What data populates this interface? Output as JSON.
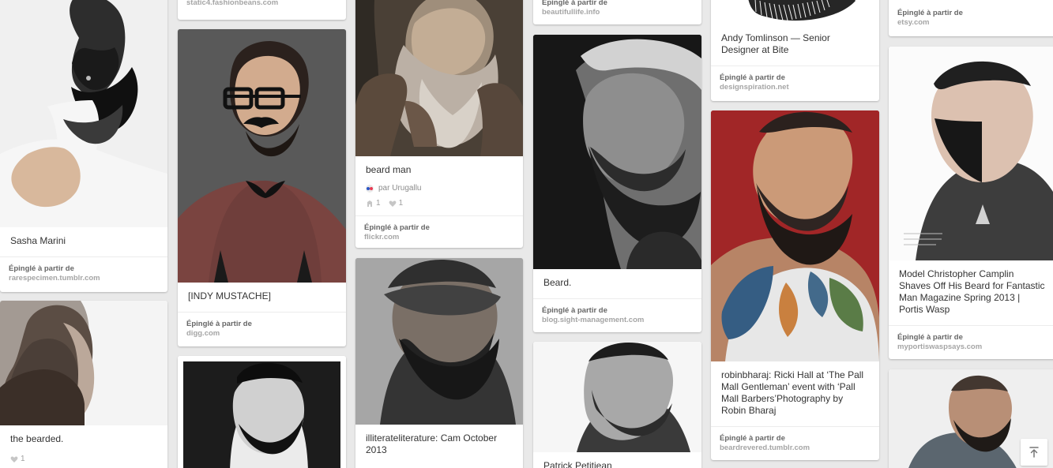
{
  "columns": [
    {
      "pins": [
        {
          "description": "Sasha Marini",
          "source": {
            "label": "Épinglé à partir de",
            "domain": "rarespecimen.tumblr.com"
          }
        },
        {
          "description": "the bearded.",
          "stats": {
            "likes": "1"
          }
        }
      ]
    },
    {
      "pins": [
        {
          "source": {
            "domain": "static4.fashionbeans.com"
          }
        },
        {
          "description": "[INDY MUSTACHE]",
          "source": {
            "label": "Épinglé à partir de",
            "domain": "digg.com"
          }
        }
      ]
    },
    {
      "pins": [
        {
          "description": "beard man",
          "pinner": "par Urugallu",
          "stats": {
            "repins": "1",
            "likes": "1"
          },
          "source": {
            "label": "Épinglé à partir de",
            "domain": "flickr.com"
          }
        },
        {
          "description": "illiterateliterature: Cam October 2013"
        }
      ]
    },
    {
      "pins": [
        {
          "source": {
            "label": "Épinglé à partir de",
            "domain": "beautifullife.info"
          }
        },
        {
          "description": "Beard.",
          "source": {
            "label": "Épinglé à partir de",
            "domain": "blog.sight-management.com"
          }
        },
        {
          "description": "Patrick Petitjean"
        }
      ]
    },
    {
      "pins": [
        {
          "description": "Andy Tomlinson — Senior Designer at Bite",
          "source": {
            "label": "Épinglé à partir de",
            "domain": "designspiration.net"
          }
        },
        {
          "description": "robinbharaj: Ricki Hall at ‘The Pall Mall Gentleman’ event with ‘Pall Mall Barbers’Photography by Robin Bharaj",
          "source": {
            "label": "Épinglé à partir de",
            "domain": "beardrevered.tumblr.com"
          }
        }
      ]
    },
    {
      "pins": [
        {
          "source": {
            "label": "Épinglé à partir de",
            "domain": "etsy.com"
          }
        },
        {
          "description": "Model Christopher Camplin Shaves Off His Beard for Fantastic Man Magazine Spring 2013 | Portis Wasp",
          "source": {
            "label": "Épinglé à partir de",
            "domain": "myportiswaspsays.com"
          }
        }
      ]
    }
  ],
  "colors": {
    "page_background": "#e9e9e9",
    "card_background": "#ffffff",
    "source_label": "#666666",
    "source_domain": "#a5a5a5",
    "pin_text": "#333333"
  }
}
